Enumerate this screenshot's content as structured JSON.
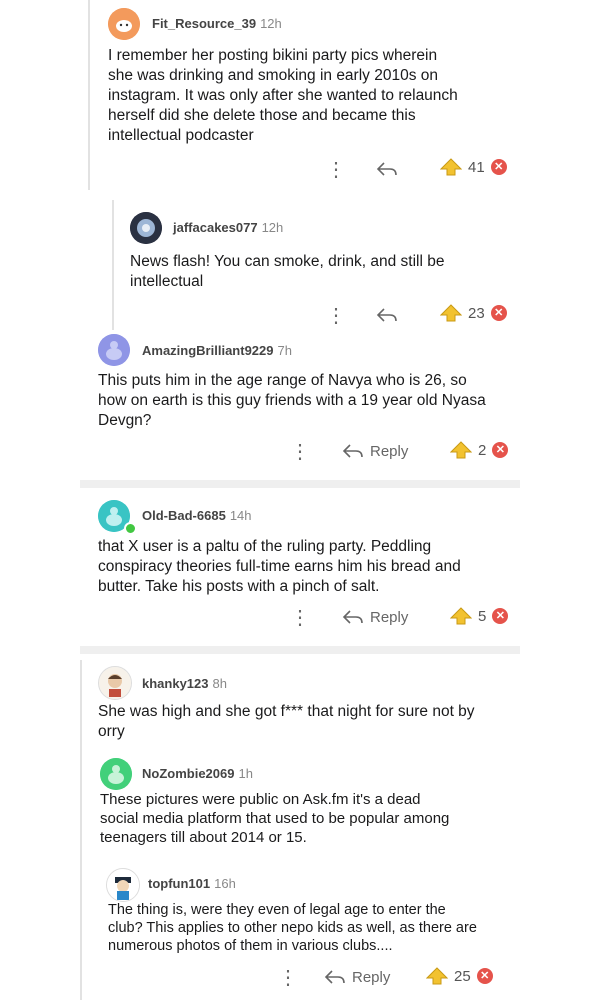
{
  "comments": [
    {
      "user": "Fit_Resource_39",
      "time": "12h",
      "lines": [
        "I remember her posting bikini party pics wherein",
        "she was drinking and smoking in early 2010s on",
        "instagram. It was only after she wanted to relaunch",
        "herself did she delete those and became this",
        "intellectual podcaster"
      ],
      "votes": "41"
    },
    {
      "user": "jaffacakes077",
      "time": "12h",
      "lines": [
        "News flash! You can smoke, drink, and still be",
        "intellectual"
      ],
      "votes": "23"
    },
    {
      "user": "AmazingBrilliant9229",
      "time": "7h",
      "lines": [
        "This puts him in the age range of Navya who is 26, so",
        "how on earth is this guy friends with a 19 year old Nyasa",
        "Devgn?"
      ],
      "reply_label": "Reply",
      "votes": "2"
    },
    {
      "user": "Old-Bad-6685",
      "time": "14h",
      "lines": [
        "that X user is a paltu of the ruling party. Peddling",
        "conspiracy theories full-time earns him his bread and",
        "butter. Take his posts with a pinch of salt."
      ],
      "reply_label": "Reply",
      "votes": "5"
    },
    {
      "user": "khanky123",
      "time": "8h",
      "lines": [
        "She was high and she got f*** that night for sure not by",
        "orry"
      ]
    },
    {
      "user": "NoZombie2069",
      "time": "1h",
      "lines": [
        "These pictures were public on Ask.fm it's a dead",
        "social media platform that used to be popular among",
        "teenagers till about 2014 or 15."
      ]
    },
    {
      "user": "topfun101",
      "time": "16h",
      "lines": [
        "The thing is, were they even of legal age to enter the",
        "club? This applies to other nepo kids as well, as there are",
        "numerous photos of them in various clubs...."
      ],
      "reply_label": "Reply",
      "votes": "25"
    }
  ],
  "icons": {
    "more": "more-vertical-icon",
    "reply": "reply-arrow-icon",
    "upvote": "upvote-icon",
    "downvote": "downvote-icon"
  },
  "colors": {
    "upvote": "#f2c230",
    "downvote": "#e5534b",
    "avatar_orange": "#f39a5c",
    "avatar_purple": "#8f95e6",
    "avatar_teal": "#39c4c4",
    "avatar_green": "#42d07a"
  }
}
